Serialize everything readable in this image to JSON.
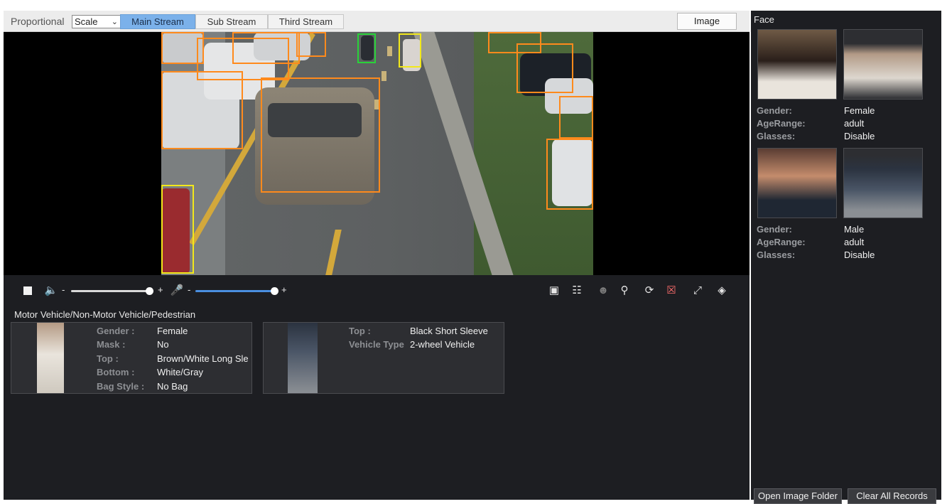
{
  "toolbar": {
    "proportional_label": "Proportional",
    "scale_select_value": "Scale",
    "tabs": [
      {
        "label": "Main Stream",
        "active": true
      },
      {
        "label": "Sub Stream",
        "active": false
      },
      {
        "label": "Third Stream",
        "active": false
      }
    ],
    "image_button": "Image"
  },
  "controls": {
    "speaker_minus": "-",
    "speaker_plus": "+",
    "speaker_volume_fraction": 1.0,
    "mic_minus": "-",
    "mic_plus": "+",
    "mic_volume_fraction": 1.0
  },
  "info_panel": {
    "title": "Motor Vehicle/Non-Motor Vehicle/Pedestrian",
    "cards": [
      {
        "rows": [
          {
            "key": "Gender :",
            "value": "Female"
          },
          {
            "key": "Mask :",
            "value": "No"
          },
          {
            "key": "Top :",
            "value": "Brown/White Long Sle"
          },
          {
            "key": "Bottom :",
            "value": "White/Gray"
          },
          {
            "key": "Bag Style :",
            "value": "No Bag"
          }
        ]
      },
      {
        "rows": [
          {
            "key": "Top :",
            "value": "Black Short Sleeve"
          },
          {
            "key": "Vehicle Type",
            "value": "2-wheel Vehicle"
          }
        ]
      }
    ]
  },
  "face_panel": {
    "title": "Face",
    "records": [
      {
        "attributes": [
          {
            "key": "Gender:",
            "value": "Female"
          },
          {
            "key": "AgeRange:",
            "value": "adult"
          },
          {
            "key": "Glasses:",
            "value": "Disable"
          }
        ]
      },
      {
        "attributes": [
          {
            "key": "Gender:",
            "value": "Male"
          },
          {
            "key": "AgeRange:",
            "value": "adult"
          },
          {
            "key": "Glasses:",
            "value": "Disable"
          }
        ]
      }
    ],
    "open_folder_button": "Open Image Folder",
    "clear_records_button": "Clear All Records"
  },
  "colors": {
    "active_tab": "#7bb1ea",
    "detect_vehicle": "#ff8a1c",
    "detect_nonmotor": "#f2e81b",
    "detect_pedestrian": "#29d239",
    "panel_bg": "#1d1e22"
  }
}
